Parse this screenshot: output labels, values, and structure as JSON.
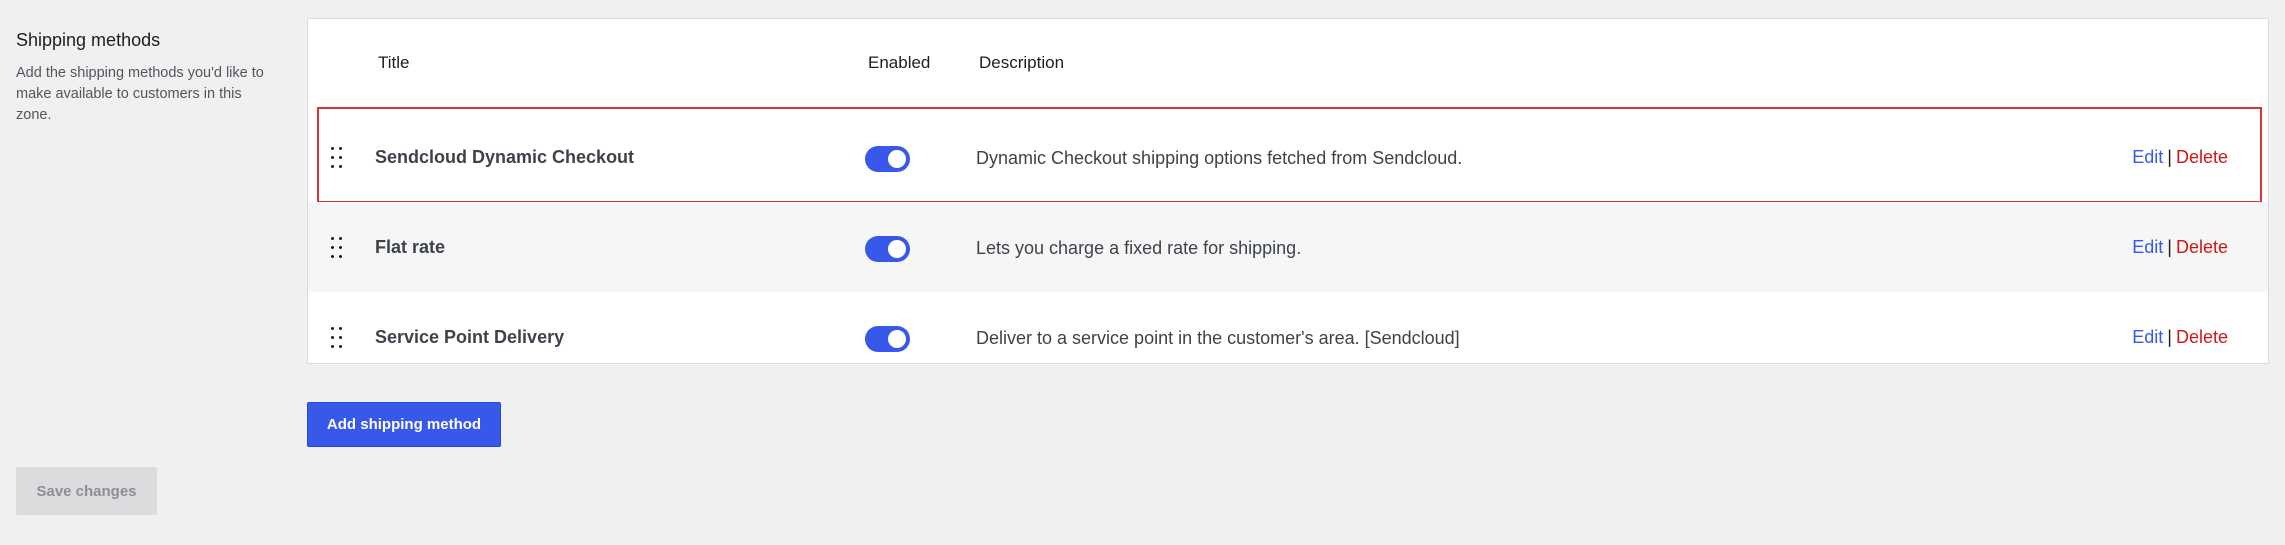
{
  "section": {
    "title": "Shipping methods",
    "description": "Add the shipping methods you'd like to make available to customers in this zone."
  },
  "table": {
    "headers": {
      "title": "Title",
      "enabled": "Enabled",
      "description": "Description"
    },
    "rows": [
      {
        "title": "Sendcloud Dynamic Checkout",
        "enabled": true,
        "description": "Dynamic Checkout shipping options fetched from Sendcloud.",
        "edit": "Edit",
        "sep": "|",
        "delete": "Delete"
      },
      {
        "title": "Flat rate",
        "enabled": true,
        "description": "Lets you charge a fixed rate for shipping.",
        "edit": "Edit",
        "sep": "|",
        "delete": "Delete"
      },
      {
        "title": "Service Point Delivery",
        "enabled": true,
        "description": "Deliver to a service point in the customer's area. [Sendcloud]",
        "edit": "Edit",
        "sep": "|",
        "delete": "Delete"
      }
    ]
  },
  "buttons": {
    "add": "Add shipping method",
    "save": "Save changes"
  },
  "colors": {
    "accent": "#3858e9",
    "danger": "#cc1818",
    "highlight": "#d63638"
  }
}
